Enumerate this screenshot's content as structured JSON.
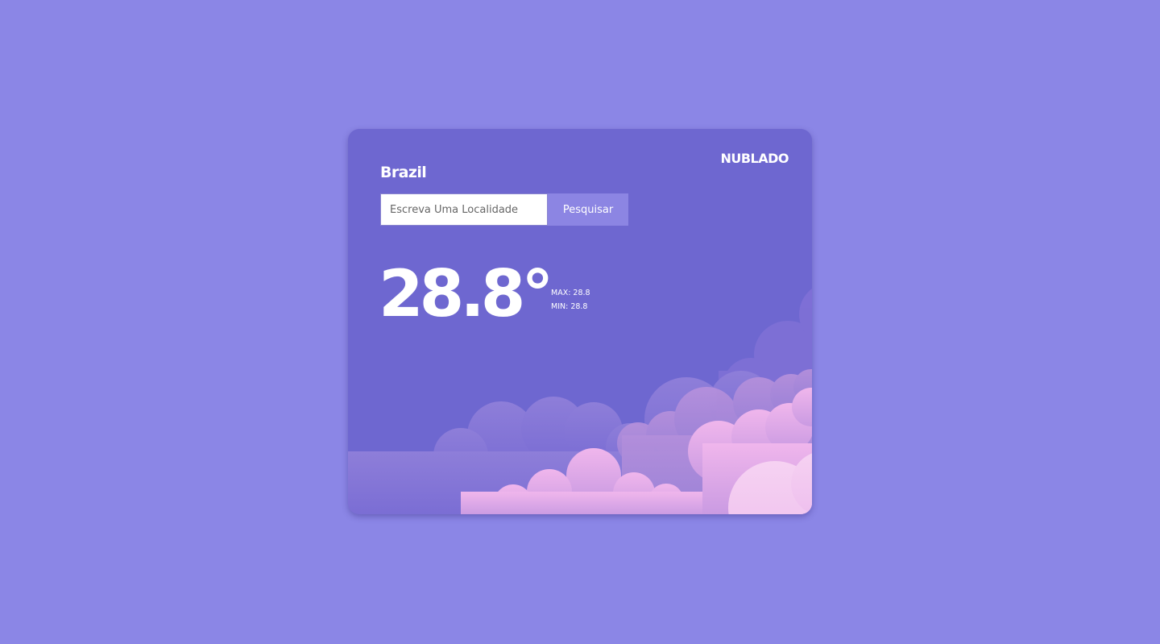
{
  "weather": {
    "location": "Brazil",
    "condition": "NUBLADO",
    "temperature": "28.8°",
    "max_label": "MAX: 28.8",
    "min_label": "MIN: 28.8"
  },
  "search": {
    "placeholder": "Escreva Uma Localidade",
    "value": "",
    "button_label": "Pesquisar"
  },
  "colors": {
    "page_background": "#8b86e6",
    "card_background": "#6e67d0",
    "button_background": "#8c85e3",
    "cloud_purple": "#8f7fdc",
    "cloud_pink": "#e9b4ec"
  }
}
